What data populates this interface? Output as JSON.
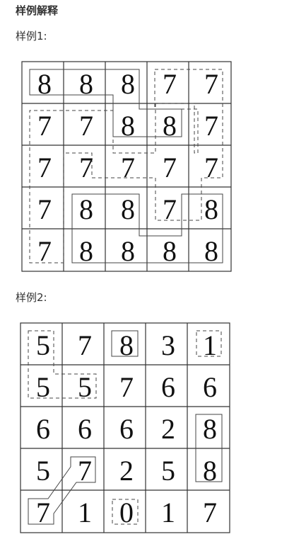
{
  "section": {
    "heading": "样例解释",
    "examples": [
      {
        "label": "样例1:",
        "grid": [
          [
            "8",
            "8",
            "8",
            "7",
            "7"
          ],
          [
            "7",
            "7",
            "8",
            "8",
            "7"
          ],
          [
            "7",
            "7",
            "7",
            "7",
            "7"
          ],
          [
            "7",
            "8",
            "8",
            "7",
            "8"
          ],
          [
            "7",
            "8",
            "8",
            "8",
            "8"
          ]
        ]
      },
      {
        "label": "样例2:",
        "grid": [
          [
            "5",
            "7",
            "8",
            "3",
            "1"
          ],
          [
            "5",
            "5",
            "7",
            "6",
            "6"
          ],
          [
            "6",
            "6",
            "6",
            "2",
            "8"
          ],
          [
            "5",
            "7",
            "2",
            "5",
            "8"
          ],
          [
            "7",
            "1",
            "0",
            "1",
            "7"
          ]
        ]
      }
    ]
  }
}
